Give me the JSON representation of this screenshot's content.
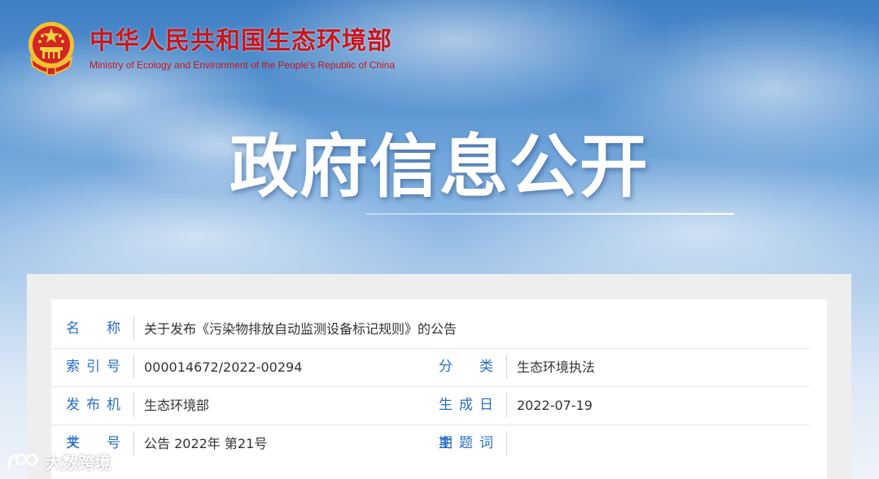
{
  "header": {
    "ministry_name_cn": "中华人民共和国生态环境部",
    "ministry_name_en": "Ministry of Ecology and Environment of the People's Republic of China"
  },
  "banner": {
    "title": "政府信息公开"
  },
  "document_info": {
    "name_label": "名 称",
    "name_value": "关于发布《污染物排放自动监测设备标记规则》的公告",
    "index_label": "索引号",
    "index_value": "000014672/2022-00294",
    "category_label": "分 类",
    "category_value": "生态环境执法",
    "issuer_label": "发布机关",
    "issuer_value": "生态环境部",
    "date_label": "生成日期",
    "date_value": "2022-07-19",
    "doc_no_label": "文 号",
    "doc_no_value": "公告 2022年 第21号",
    "subject_label": "主题词",
    "subject_value": ""
  },
  "watermark": {
    "text": "大数跨境"
  },
  "colors": {
    "ministry_red": "#c8161d",
    "label_blue": "#2a6ec4",
    "value_text": "#333333"
  },
  "icons": {
    "emblem": "national-emblem-icon",
    "watermark_logo": "watermark-logo-icon"
  }
}
